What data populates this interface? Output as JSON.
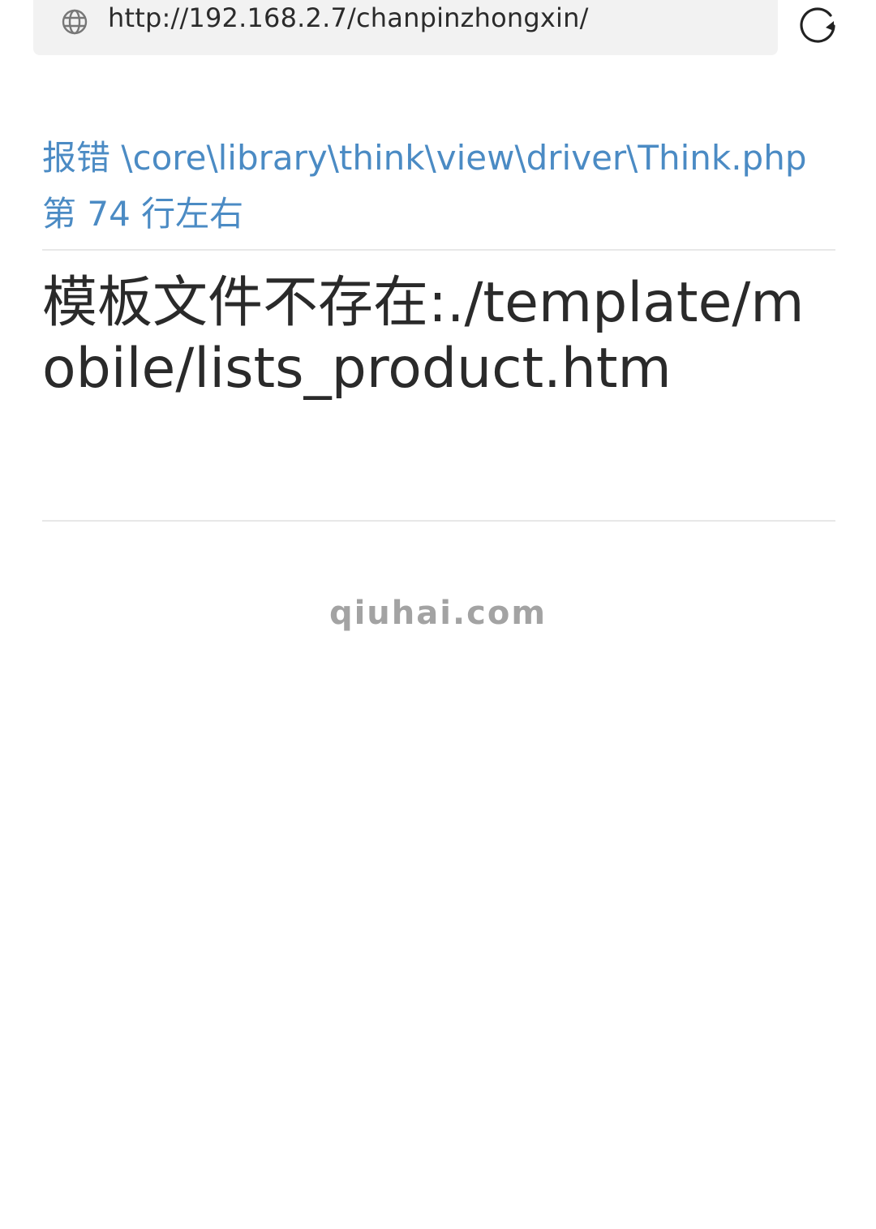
{
  "browser": {
    "url": "http://192.168.2.7/chanpinzhongxin/"
  },
  "error": {
    "location": "报错 \\core\\library\\think\\view\\driver\\Think.php 第 74 行左右",
    "message": "模板文件不存在:./template/mobile/lists_product.htm"
  },
  "footer": {
    "brand": "qiuhai.com"
  },
  "colors": {
    "link": "#4b8bc4",
    "text": "#2a2a2a",
    "muted": "#a3a3a3",
    "address_bar": "#f2f2f2"
  },
  "icons": {
    "address_icon": "globe-icon",
    "reload_icon": "reload-icon"
  }
}
